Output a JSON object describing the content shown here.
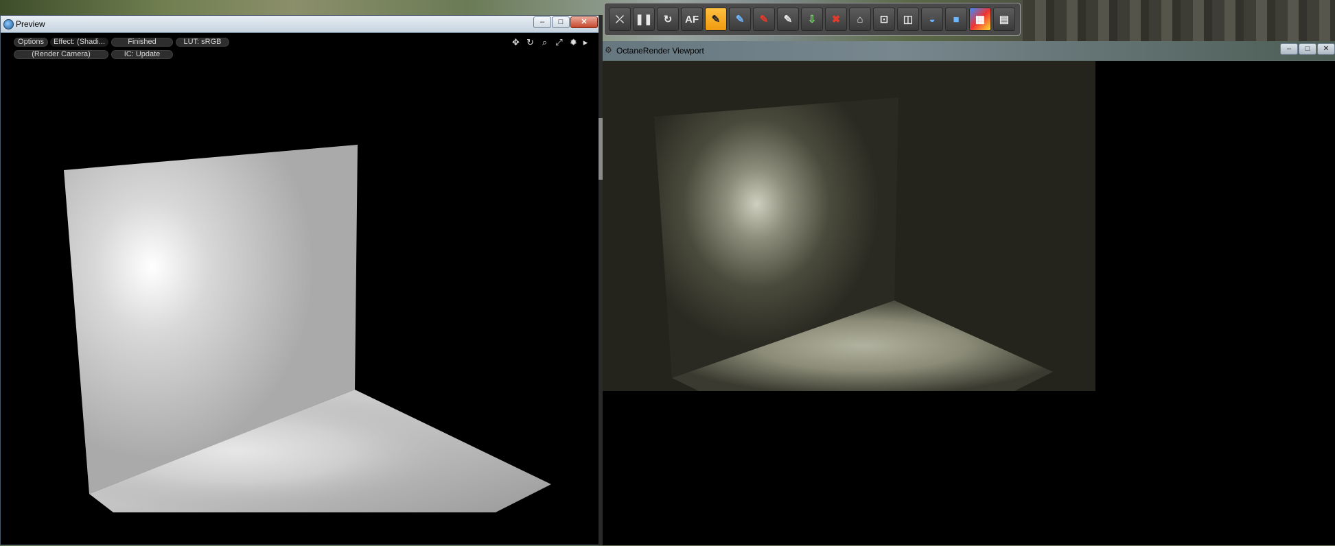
{
  "preview_window": {
    "title": "Preview",
    "controls": [
      "Options",
      "Effect: (Shadi...",
      "Finished",
      "LUT: sRGB",
      "(Render Camera)",
      "IC: Update"
    ],
    "window_buttons": {
      "minimize": "–",
      "maximize": "□",
      "close": "✕"
    }
  },
  "octane_toolbar": {
    "buttons": [
      {
        "name": "collapse",
        "glyph": "⤫"
      },
      {
        "name": "pause",
        "glyph": "❚❚"
      },
      {
        "name": "restart",
        "glyph": "↻"
      },
      {
        "name": "autofocus",
        "glyph": "AF"
      },
      {
        "name": "pick-focus",
        "glyph": "✎"
      },
      {
        "name": "pick-material",
        "glyph": "✎"
      },
      {
        "name": "pick-object",
        "glyph": "✎"
      },
      {
        "name": "pick-white-balance",
        "glyph": "✎"
      },
      {
        "name": "send-to",
        "glyph": "⇩"
      },
      {
        "name": "clear",
        "glyph": "✖"
      },
      {
        "name": "region",
        "glyph": "⌂"
      },
      {
        "name": "zoom-region",
        "glyph": "⊡"
      },
      {
        "name": "snapshot",
        "glyph": "◫"
      },
      {
        "name": "clay",
        "glyph": "◒"
      },
      {
        "name": "cube",
        "glyph": "■"
      },
      {
        "name": "gradient",
        "glyph": "▦"
      },
      {
        "name": "settings",
        "glyph": "▤"
      }
    ],
    "active_index": 4
  },
  "octane_window": {
    "title": "OctaneRender Viewport",
    "window_buttons": {
      "minimize": "–",
      "maximize": "□",
      "close": "✕"
    }
  }
}
